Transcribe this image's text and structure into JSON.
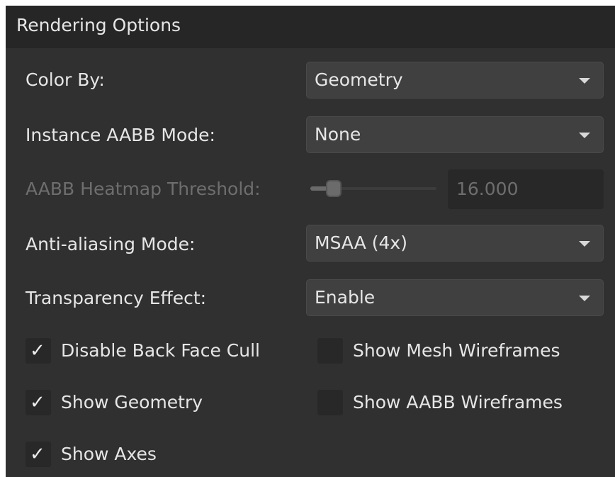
{
  "panel": {
    "title": "Rendering Options"
  },
  "rows": {
    "color_by": {
      "label": "Color By:",
      "value": "Geometry"
    },
    "instance_aabb_mode": {
      "label": "Instance AABB Mode:",
      "value": "None"
    },
    "aabb_heatmap_threshold": {
      "label": "AABB Heatmap Threshold:",
      "value": "16.000",
      "slider_fraction": 0.1,
      "enabled": false
    },
    "anti_aliasing_mode": {
      "label": "Anti-aliasing Mode:",
      "value": "MSAA (4x)"
    },
    "transparency_effect": {
      "label": "Transparency Effect:",
      "value": "Enable"
    }
  },
  "checkboxes": {
    "disable_back_face_cull": {
      "label": "Disable Back Face Cull",
      "checked": true
    },
    "show_geometry": {
      "label": "Show Geometry",
      "checked": true
    },
    "show_axes": {
      "label": "Show Axes",
      "checked": true
    },
    "show_mesh_wireframes": {
      "label": "Show Mesh Wireframes",
      "checked": false
    },
    "show_aabb_wireframes": {
      "label": "Show AABB Wireframes",
      "checked": false
    }
  },
  "icons": {
    "check": "✓",
    "dropdown_arrow": "chevron-down-icon"
  },
  "colors": {
    "panel_bg": "#303030",
    "header_bg": "#262626",
    "control_bg": "#404040",
    "text": "#e6e6e6",
    "disabled_text": "#6e6e6e"
  }
}
